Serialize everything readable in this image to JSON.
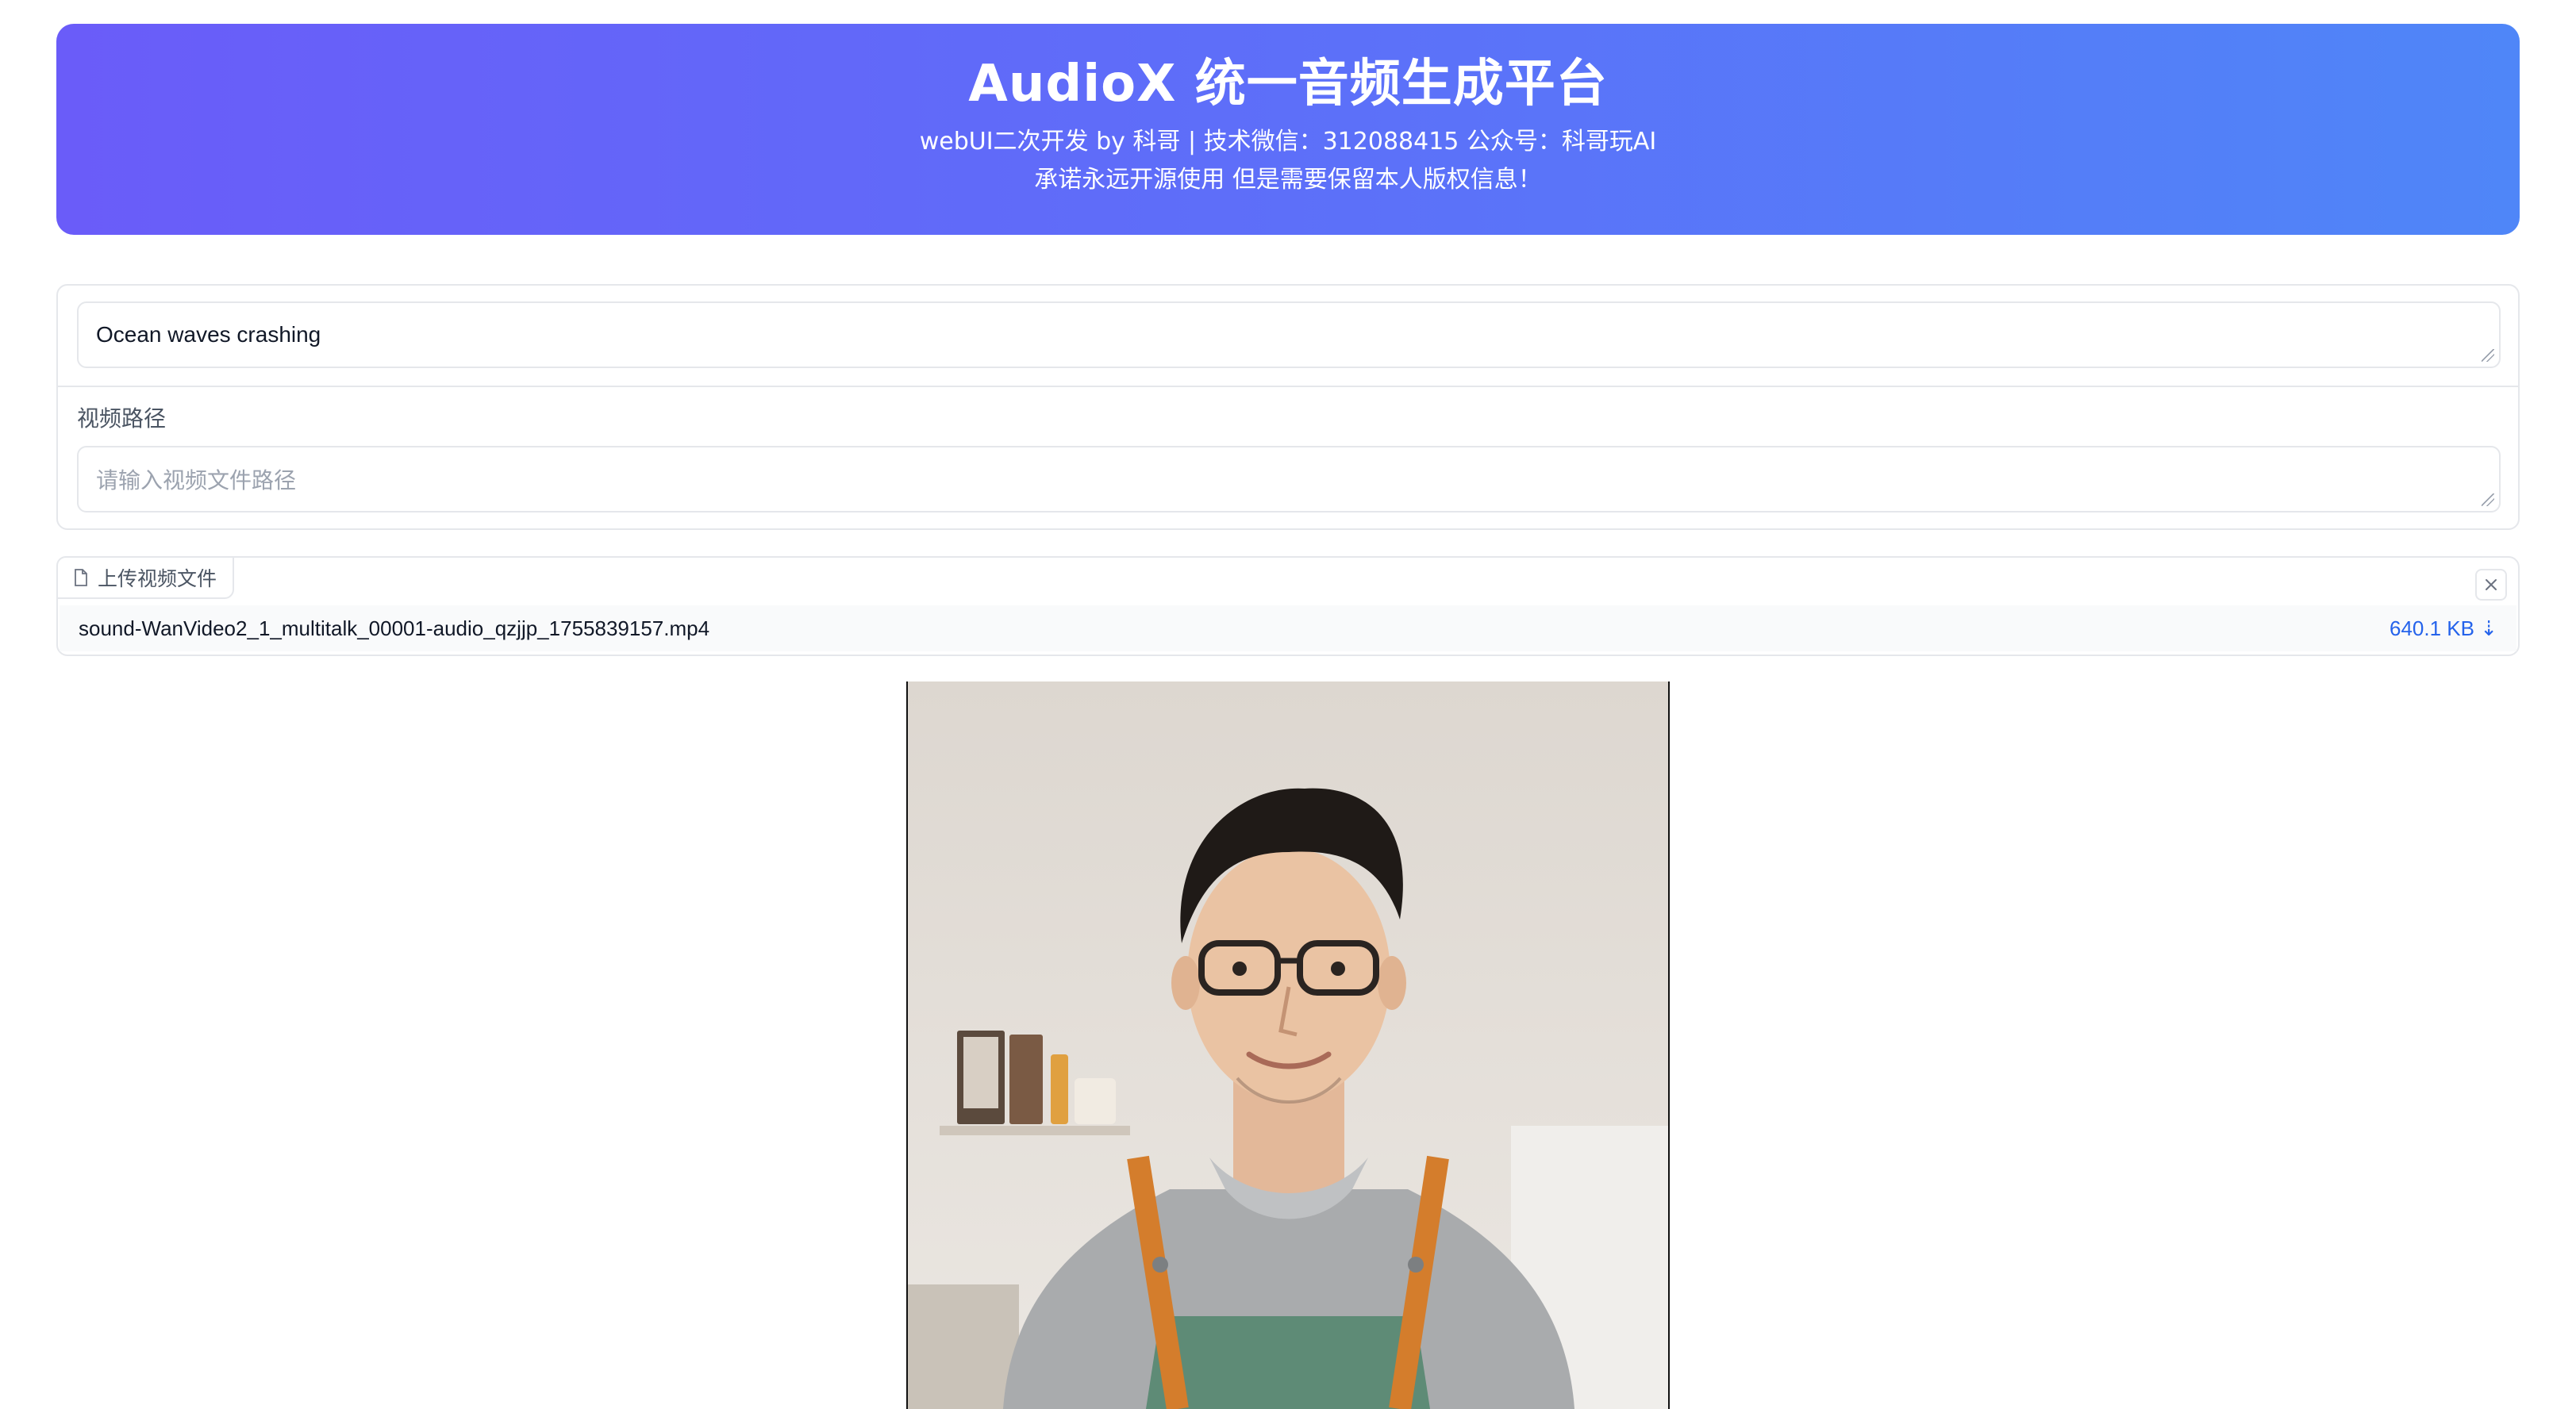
{
  "header": {
    "title": "AudioX 统一音频生成平台",
    "subtitle_line1": "webUI二次开发 by 科哥 | 技术微信：312088415 公众号：科哥玩AI",
    "subtitle_line2": "承诺永远开源使用 但是需要保留本人版权信息！",
    "gradient_start": "#6a5cf9",
    "gradient_end": "#4f86f8"
  },
  "form": {
    "prompt_value": "Ocean waves crashing",
    "video_path_label": "视频路径",
    "video_path_placeholder": "请输入视频文件路径"
  },
  "upload": {
    "tag_label": "上传视频文件",
    "file_name": "sound-WanVideo2_1_multitalk_00001-audio_qzjjp_1755839157.mp4",
    "file_size": "640.1 KB ⇣",
    "close_icon": "close-icon",
    "file_icon": "file-icon"
  },
  "video_preview": {
    "icon": "video-thumbnail"
  }
}
